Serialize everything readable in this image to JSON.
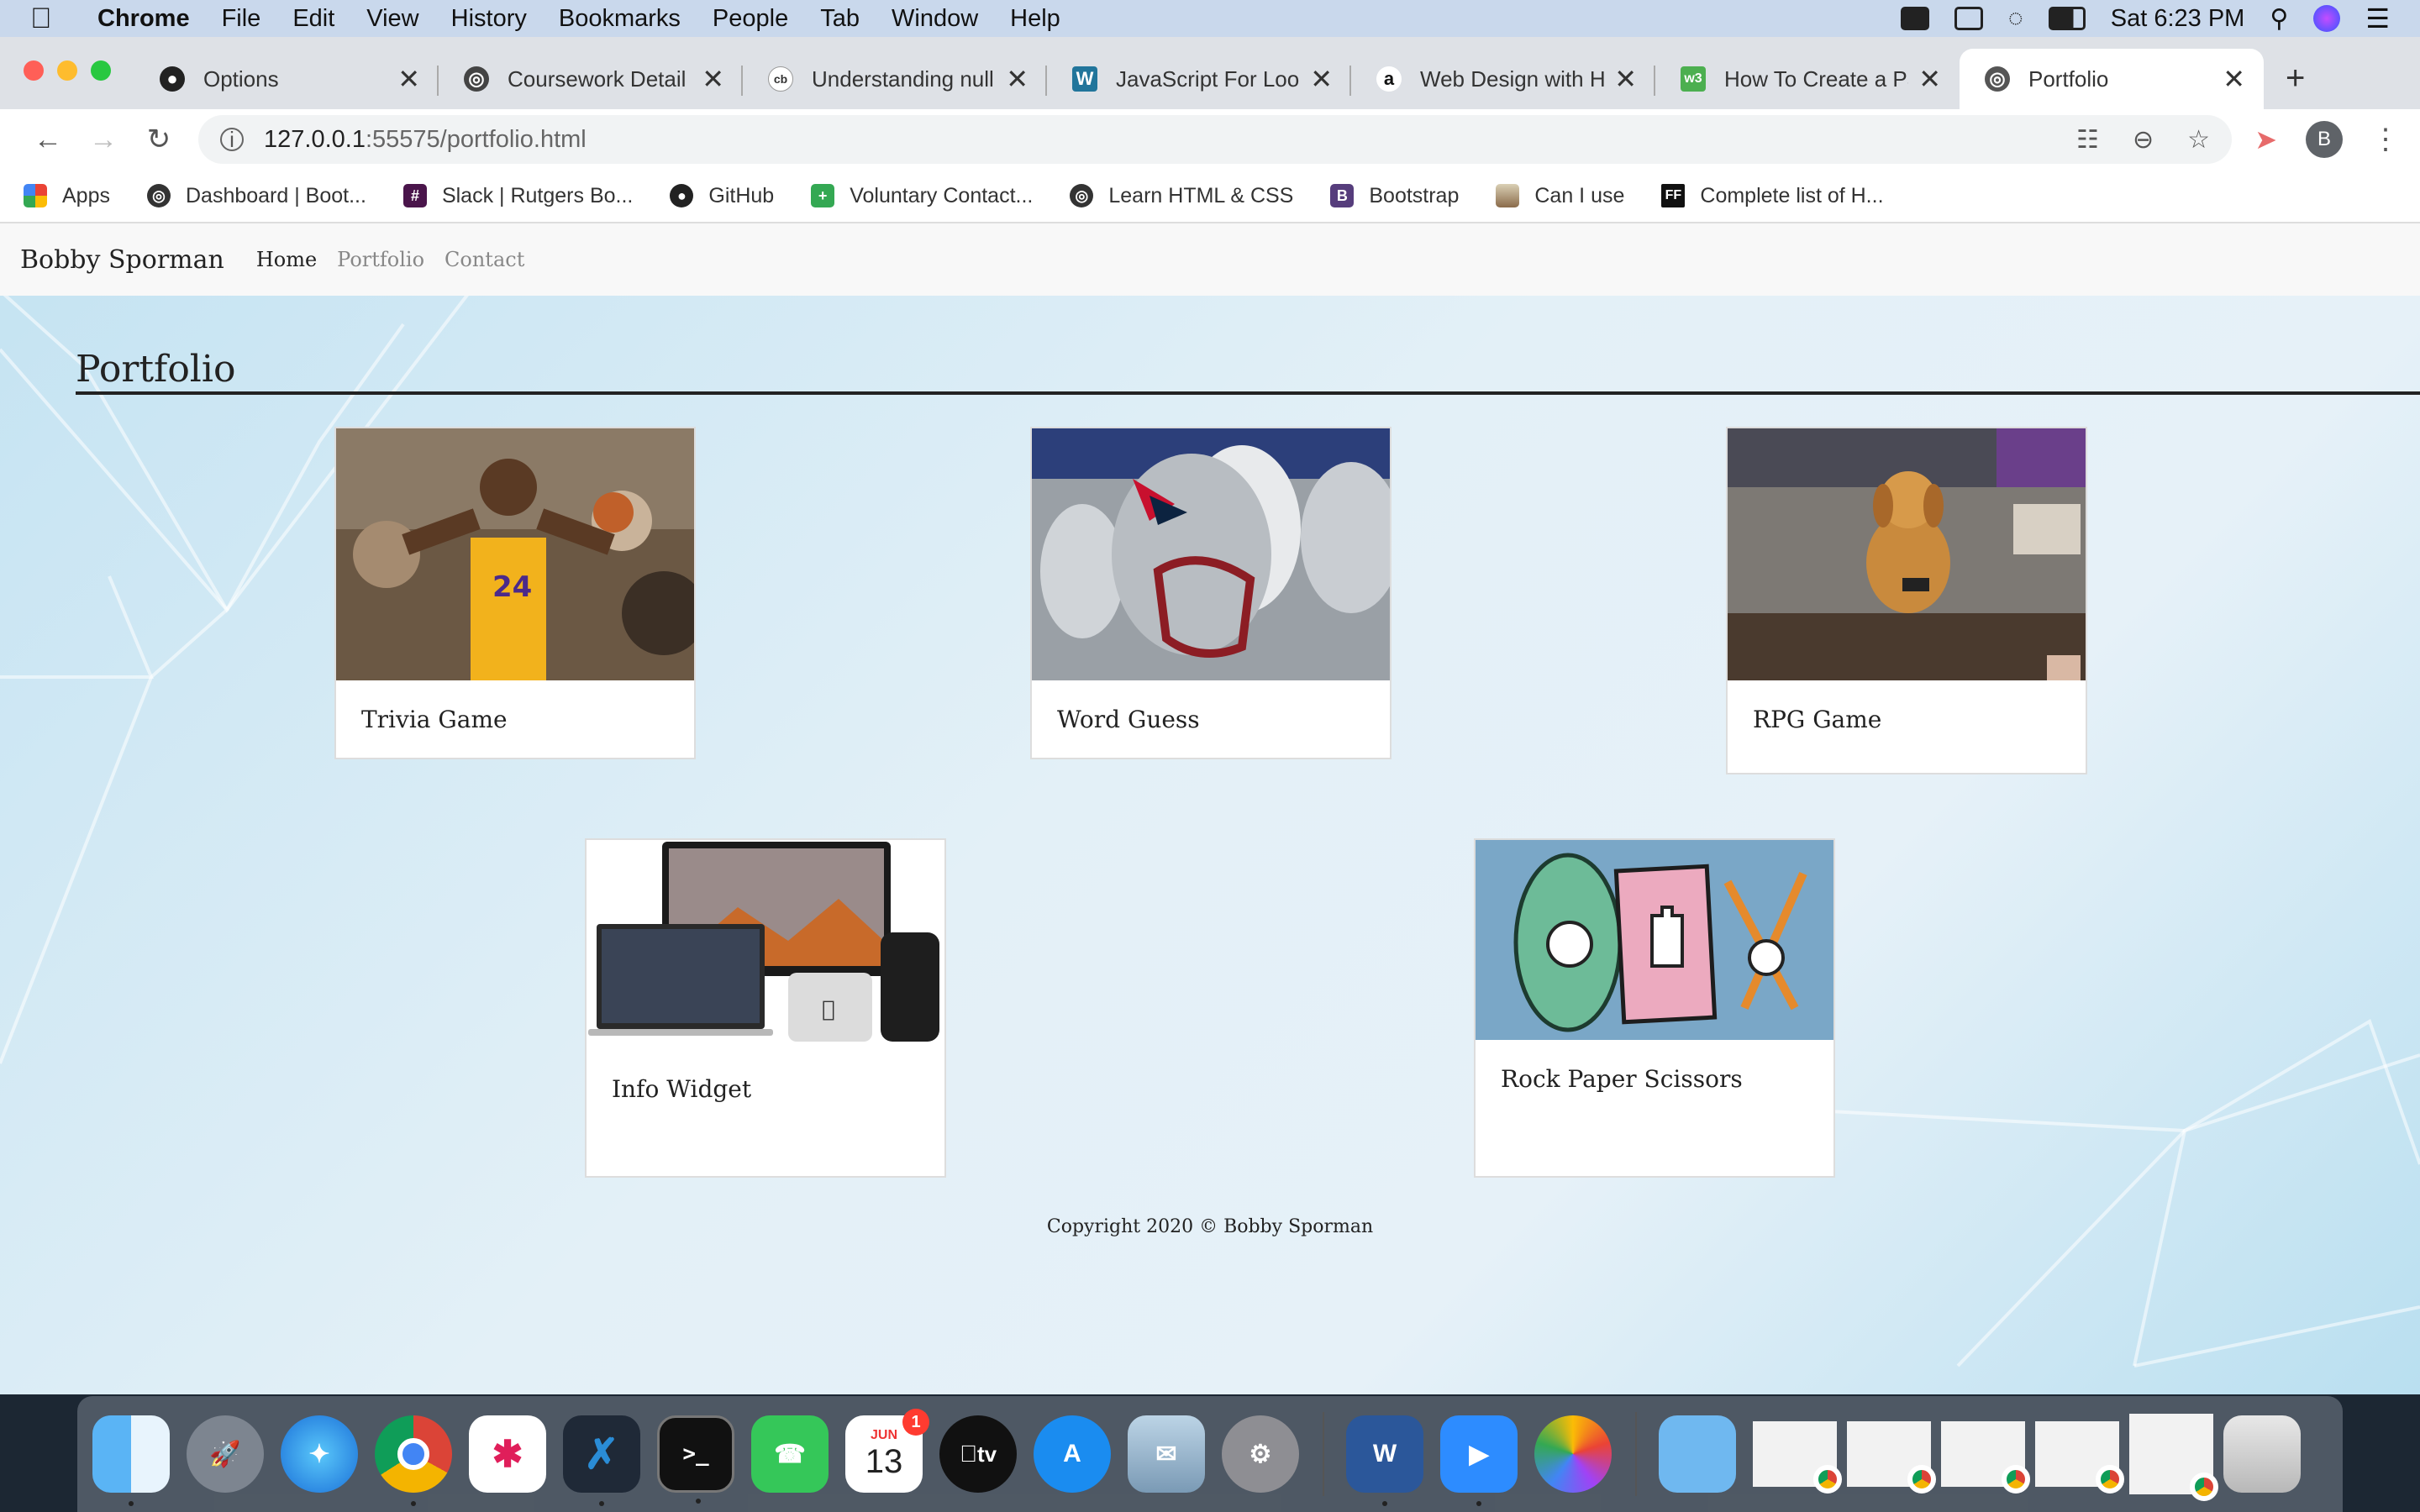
{
  "menubar": {
    "items": [
      "Chrome",
      "File",
      "Edit",
      "View",
      "History",
      "Bookmarks",
      "People",
      "Tab",
      "Window",
      "Help"
    ],
    "clock": "Sat 6:23 PM"
  },
  "tabs": [
    {
      "label": "Options",
      "icon": "github-icon",
      "active": false
    },
    {
      "label": "Coursework Detail | B",
      "icon": "globe-icon",
      "active": false
    },
    {
      "label": "Understanding null, u",
      "icon": "codeburst-icon",
      "active": false
    },
    {
      "label": "JavaScript For Loops",
      "icon": "wordpress-icon",
      "active": false
    },
    {
      "label": "Web Design with HT",
      "icon": "amazon-icon",
      "active": false
    },
    {
      "label": "How To Create a Para",
      "icon": "w3schools-icon",
      "active": false
    },
    {
      "label": "Portfolio",
      "icon": "globe-icon",
      "active": true
    }
  ],
  "address": {
    "host": "127.0.0.1",
    "rest": ":55575/portfolio.html"
  },
  "profile_initial": "B",
  "bookmarks": [
    {
      "label": "Apps",
      "icon": "apps-grid-icon"
    },
    {
      "label": "Dashboard | Boot...",
      "icon": "globe-icon"
    },
    {
      "label": "Slack | Rutgers Bo...",
      "icon": "slack-icon"
    },
    {
      "label": "GitHub",
      "icon": "github-icon"
    },
    {
      "label": "Voluntary Contact...",
      "icon": "plus-square-icon"
    },
    {
      "label": "Learn HTML & CSS",
      "icon": "globe-icon"
    },
    {
      "label": "Bootstrap",
      "icon": "bootstrap-icon"
    },
    {
      "label": "Can I use",
      "icon": "caniuse-icon"
    },
    {
      "label": "Complete list of H...",
      "icon": "ff-icon"
    }
  ],
  "site": {
    "brand": "Bobby Sporman",
    "nav": [
      "Home",
      "Portfolio",
      "Contact"
    ],
    "title": "Portfolio",
    "projects": [
      {
        "caption": "Trivia Game",
        "image": "basketball-player-photo"
      },
      {
        "caption": "Word Guess",
        "image": "football-helmets-photo"
      },
      {
        "caption": "RPG Game",
        "image": "puppy-on-couch-photo"
      },
      {
        "caption": "Info Widget",
        "image": "apple-devices-photo"
      },
      {
        "caption": "Rock Paper Scissors",
        "image": "rock-paper-scissors-illustration"
      }
    ],
    "footer": "Copyright 2020 © Bobby Sporman"
  },
  "dock": {
    "calendar_month": "JUN",
    "calendar_day": "13",
    "calendar_badge": "1",
    "word_letter": "W",
    "tv_label": "tv"
  },
  "colors": {
    "menubar": "#c9d8ec",
    "tabstrip": "#dee1e6",
    "page_bg": "#dcecf5",
    "site_nav_bg": "#f8f8f8"
  }
}
